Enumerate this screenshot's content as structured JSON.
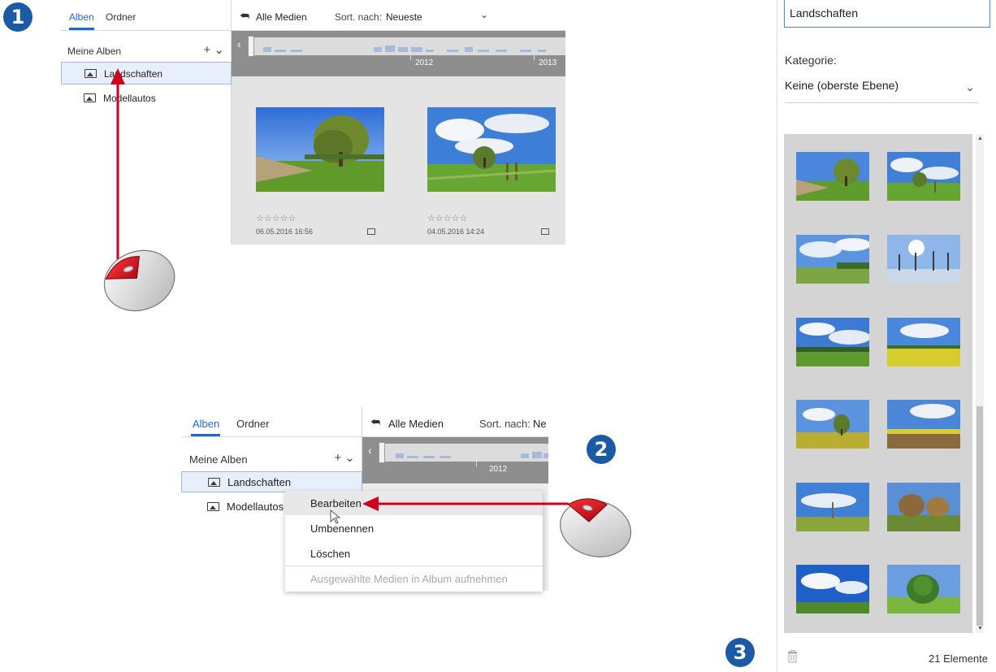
{
  "steps": {
    "one": "1",
    "two": "2",
    "three": "3"
  },
  "panel1": {
    "tabs": [
      "Alben",
      "Ordner"
    ],
    "albums_heading": "Meine Alben",
    "add_icon": "+ ⌄",
    "albums": [
      "Landschaften",
      "Modellautos"
    ],
    "back_label": "Alle Medien",
    "sort_label": "Sort. nach:",
    "sort_value": "Neueste",
    "timeline_years": [
      "2012",
      "2013"
    ],
    "photos": [
      {
        "rating": "☆☆☆☆☆",
        "date": "06.05.2016 16:56"
      },
      {
        "rating": "☆☆☆☆☆",
        "date": "04.05.2016 14:24"
      }
    ]
  },
  "panel2": {
    "tabs": [
      "Alben",
      "Ordner"
    ],
    "albums_heading": "Meine Alben",
    "add_icon": "+ ⌄",
    "albums": [
      "Landschaften",
      "Modellautos"
    ],
    "back_label": "Alle Medien",
    "sort_label": "Sort. nach:",
    "sort_value": "Ne",
    "timeline_year": "2012",
    "context_menu": [
      "Bearbeiten",
      "Umbenennen",
      "Löschen",
      "Ausgewählte Medien in Album aufnehmen"
    ]
  },
  "editor": {
    "name_value": "Landschaften",
    "category_label": "Kategorie:",
    "category_value": "Keine (oberste Ebene)",
    "element_count": "21 Elemente"
  },
  "colors": {
    "accent": "#1a6ac9",
    "badge": "#1a5aa6",
    "arrow": "#d0021b"
  }
}
